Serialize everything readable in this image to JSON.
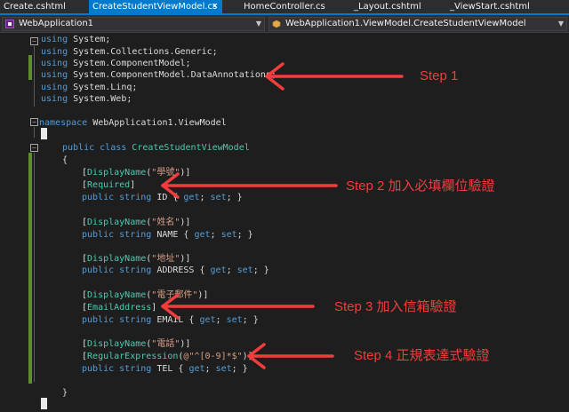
{
  "tabs": [
    {
      "label": "Create.cshtml"
    },
    {
      "label": "CreateStudentViewModel.cs"
    },
    {
      "label": "HomeController.cs"
    },
    {
      "label": "_Layout.cshtml"
    },
    {
      "label": "_ViewStart.cshtml"
    }
  ],
  "tab_close_glyph": "×",
  "navbar": {
    "project": "WebApplication1",
    "class_path": "WebApplication1.ViewModel.CreateStudentViewModel",
    "dropdown_glyph": "▼"
  },
  "code": {
    "line1": [
      "using",
      " System;"
    ],
    "line2": [
      "using",
      " System.Collections.Generic;"
    ],
    "line3": [
      "using",
      " System.ComponentModel;"
    ],
    "line4": [
      "using",
      " System.ComponentModel.DataAnnotations;"
    ],
    "line5": [
      "using",
      " System.Linq;"
    ],
    "line6": [
      "using",
      " System.Web;"
    ],
    "line8": [
      "namespace",
      " WebApplication1.ViewModel"
    ],
    "line10": [
      "public",
      " ",
      "class",
      " ",
      "CreateStudentViewModel"
    ],
    "open_brace": "{",
    "close_brace": "}",
    "id_display": [
      "[",
      "DisplayName",
      "(",
      "\"學號\"",
      ")]"
    ],
    "id_required": [
      "[",
      "Required",
      "]"
    ],
    "id_prop": [
      "public",
      " ",
      "string",
      " ",
      "ID { ",
      "get",
      "; ",
      "set",
      "; }"
    ],
    "name_display": [
      "[",
      "DisplayName",
      "(",
      "\"姓名\"",
      ")]"
    ],
    "name_prop": [
      "public",
      " ",
      "string",
      " ",
      "NAME { ",
      "get",
      "; ",
      "set",
      "; }"
    ],
    "addr_display": [
      "[",
      "DisplayName",
      "(",
      "\"地址\"",
      ")]"
    ],
    "addr_prop": [
      "public",
      " ",
      "string",
      " ",
      "ADDRESS { ",
      "get",
      "; ",
      "set",
      "; }"
    ],
    "email_display": [
      "[",
      "DisplayName",
      "(",
      "\"電子郵件\"",
      ")]"
    ],
    "email_attr": [
      "[",
      "EmailAddress",
      "]"
    ],
    "email_prop": [
      "public",
      " ",
      "string",
      " ",
      "EMAIL { ",
      "get",
      "; ",
      "set",
      "; }"
    ],
    "tel_display": [
      "[",
      "DisplayName",
      "(",
      "\"電話\"",
      ")]"
    ],
    "tel_regex": [
      "[",
      "RegularExpression",
      "(",
      "@\"^[0-9]*$\"",
      ")]"
    ],
    "tel_prop": [
      "public",
      " ",
      "string",
      " ",
      "TEL { ",
      "get",
      "; ",
      "set",
      "; }"
    ]
  },
  "annotations": {
    "step1": "Step 1",
    "step2": "Step 2 加入必填欄位驗證",
    "step3": "Step 3 加入信箱驗證",
    "step4": "Step 4 正規表達式驗證"
  },
  "colors": {
    "keyword": "#569cd6",
    "type": "#4ec9b0",
    "string": "#d69d85",
    "annotation": "#f23d3d",
    "tab_active": "#007acc",
    "change_bar": "#5f8f2b"
  }
}
